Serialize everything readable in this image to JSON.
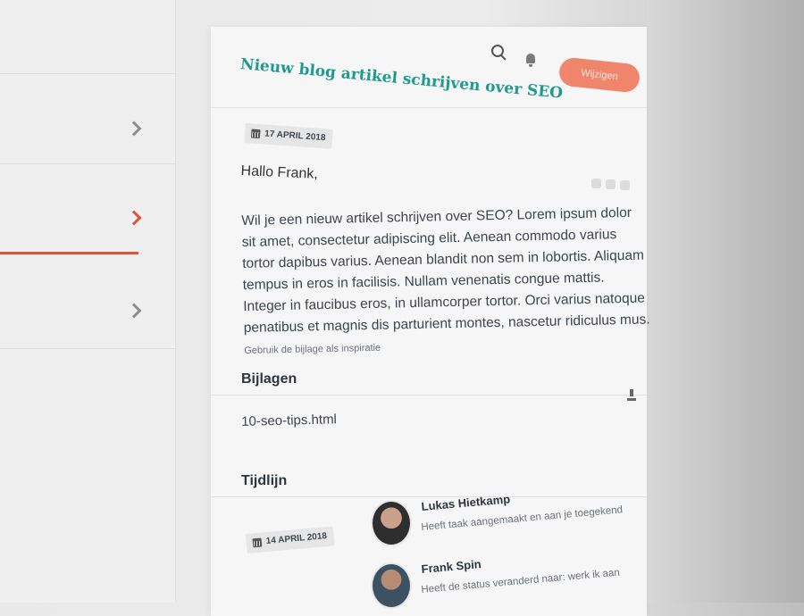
{
  "header": {
    "title": "Nieuw blog artikel schrijven over SEO",
    "action_button_label": "Wijzigen"
  },
  "task": {
    "date": "17 APRIL 2018",
    "greeting": "Hallo Frank,",
    "body_main": "Wil je een nieuw artikel schrijven over SEO? Lorem ipsum dolor sit amet, consectetur adipiscing elit. Aenean commodo varius tortor dapibus varius. Aenean blandit non sem in lobortis. Aliquam tempus in eros in facilisis. Nullam venenatis congue mattis. Integer in faucibus eros, in ullamcorper tortor. Orci varius natoque penatibus et magnis dis parturient montes, nascetur ridiculus mus.",
    "body_tail": "Gebruik de bijlage als inspiratie"
  },
  "attachments": {
    "heading": "Bijlagen",
    "items": [
      "10-seo-tips.html"
    ]
  },
  "timeline": {
    "heading": "Tijdlijn",
    "date": "14 APRIL 2018",
    "items": [
      {
        "name": "Lukas Hietkamp",
        "text": "Heeft taak aangemaakt en aan je toegekend"
      },
      {
        "name": "Frank Spin",
        "text": "Heeft de status veranderd naar: werk ik aan"
      }
    ]
  },
  "icons": {
    "search": "search-icon",
    "notifications": "bell-icon",
    "calendar": "calendar-icon",
    "download": "download-icon",
    "chevron": "chevron-right-icon"
  },
  "colors": {
    "accent": "#e0533b",
    "title": "#1f9a8e",
    "button": "#ef7a5e"
  }
}
